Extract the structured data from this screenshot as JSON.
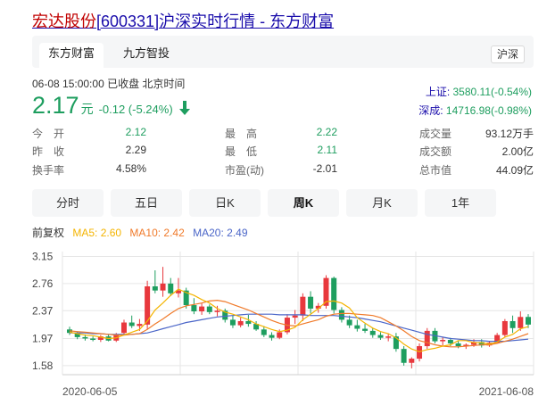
{
  "page_title": {
    "stock_name": "宏达股份",
    "code": "[600331]",
    "suffix": "沪深实时行情 - 东方财富"
  },
  "tabs": [
    {
      "label": "东方财富",
      "active": true
    },
    {
      "label": "九方智投",
      "active": false
    }
  ],
  "market_button": "沪深",
  "quote": {
    "status": "06-08 15:00:00  已收盘  北京时间",
    "price": "2.17",
    "unit": "元",
    "change": "-0.12 (-5.24%)",
    "trend": "down"
  },
  "indices": [
    {
      "name": "上证:",
      "value": "3580.11(-0.54%)"
    },
    {
      "name": "深成:",
      "value": "14716.98(-0.98%)"
    }
  ],
  "stats": [
    [
      {
        "label": "今　开",
        "value": "2.12",
        "color": "green"
      },
      {
        "label": "最　高",
        "value": "2.22",
        "color": "green"
      },
      {
        "label": "成交量",
        "value": "93.12万手",
        "color": "dark"
      }
    ],
    [
      {
        "label": "昨　收",
        "value": "2.29",
        "color": "dark"
      },
      {
        "label": "最　低",
        "value": "2.11",
        "color": "green"
      },
      {
        "label": "成交额",
        "value": "2.00亿",
        "color": "dark"
      }
    ],
    [
      {
        "label": "换手率",
        "value": "4.58%",
        "color": "dark"
      },
      {
        "label": "市盈(动)",
        "value": "-2.01",
        "color": "dark"
      },
      {
        "label": "总市值",
        "value": "44.09亿",
        "color": "dark"
      }
    ]
  ],
  "periods": [
    {
      "label": "分时",
      "active": false
    },
    {
      "label": "五日",
      "active": false
    },
    {
      "label": "日K",
      "active": false
    },
    {
      "label": "周K",
      "active": true
    },
    {
      "label": "月K",
      "active": false
    },
    {
      "label": "1年",
      "active": false
    }
  ],
  "ma_legend": {
    "adjust": "前复权",
    "ma5": "MA5: 2.60",
    "ma10": "MA10: 2.42",
    "ma20": "MA20: 2.49"
  },
  "colors": {
    "up": "#e8383d",
    "down": "#1e9e5f",
    "ma5": "#f4b400",
    "ma10": "#f07a2a",
    "ma20": "#4b66c8",
    "grid": "#e6e6e6"
  },
  "chart_data": {
    "type": "candlestick",
    "y_ticks": [
      "3.15",
      "2.76",
      "2.37",
      "1.97",
      "1.58"
    ],
    "ylim": [
      1.45,
      3.22
    ],
    "x_labels": {
      "start": "2020-06-05",
      "end": "2021-06-08"
    },
    "grid": true,
    "candles": [
      {
        "o": 2.1,
        "h": 2.14,
        "l": 2.02,
        "c": 2.05
      },
      {
        "o": 2.05,
        "h": 2.07,
        "l": 1.96,
        "c": 1.99
      },
      {
        "o": 1.99,
        "h": 2.03,
        "l": 1.94,
        "c": 1.97
      },
      {
        "o": 1.97,
        "h": 2.0,
        "l": 1.93,
        "c": 1.95
      },
      {
        "o": 1.95,
        "h": 2.02,
        "l": 1.92,
        "c": 2.0
      },
      {
        "o": 2.0,
        "h": 2.03,
        "l": 1.93,
        "c": 1.94
      },
      {
        "o": 1.94,
        "h": 2.05,
        "l": 1.92,
        "c": 2.03
      },
      {
        "o": 2.05,
        "h": 2.24,
        "l": 2.03,
        "c": 2.2
      },
      {
        "o": 2.2,
        "h": 2.3,
        "l": 2.12,
        "c": 2.15
      },
      {
        "o": 2.15,
        "h": 2.25,
        "l": 2.08,
        "c": 2.18
      },
      {
        "o": 2.17,
        "h": 2.8,
        "l": 2.1,
        "c": 2.72
      },
      {
        "o": 2.72,
        "h": 2.95,
        "l": 2.62,
        "c": 2.66
      },
      {
        "o": 2.66,
        "h": 3.0,
        "l": 2.57,
        "c": 2.76
      },
      {
        "o": 2.76,
        "h": 2.84,
        "l": 2.58,
        "c": 2.62
      },
      {
        "o": 2.62,
        "h": 2.84,
        "l": 2.56,
        "c": 2.66
      },
      {
        "o": 2.66,
        "h": 2.7,
        "l": 2.4,
        "c": 2.45
      },
      {
        "o": 2.45,
        "h": 2.55,
        "l": 2.32,
        "c": 2.36
      },
      {
        "o": 2.36,
        "h": 2.48,
        "l": 2.31,
        "c": 2.43
      },
      {
        "o": 2.43,
        "h": 2.46,
        "l": 2.32,
        "c": 2.35
      },
      {
        "o": 2.35,
        "h": 2.44,
        "l": 2.29,
        "c": 2.37
      },
      {
        "o": 2.37,
        "h": 2.4,
        "l": 2.2,
        "c": 2.24
      },
      {
        "o": 2.24,
        "h": 2.3,
        "l": 2.12,
        "c": 2.16
      },
      {
        "o": 2.16,
        "h": 2.27,
        "l": 2.13,
        "c": 2.22
      },
      {
        "o": 2.22,
        "h": 2.31,
        "l": 2.14,
        "c": 2.18
      },
      {
        "o": 2.18,
        "h": 2.22,
        "l": 2.08,
        "c": 2.1
      },
      {
        "o": 2.1,
        "h": 2.15,
        "l": 1.99,
        "c": 2.02
      },
      {
        "o": 2.02,
        "h": 2.06,
        "l": 1.94,
        "c": 1.98
      },
      {
        "o": 1.98,
        "h": 2.1,
        "l": 1.96,
        "c": 2.06
      },
      {
        "o": 2.06,
        "h": 2.32,
        "l": 2.03,
        "c": 2.27
      },
      {
        "o": 2.27,
        "h": 2.38,
        "l": 2.18,
        "c": 2.3
      },
      {
        "o": 2.3,
        "h": 2.62,
        "l": 2.22,
        "c": 2.57
      },
      {
        "o": 2.57,
        "h": 2.65,
        "l": 2.33,
        "c": 2.4
      },
      {
        "o": 2.4,
        "h": 2.48,
        "l": 2.34,
        "c": 2.44
      },
      {
        "o": 2.44,
        "h": 2.88,
        "l": 2.4,
        "c": 2.84
      },
      {
        "o": 2.84,
        "h": 2.86,
        "l": 2.33,
        "c": 2.38
      },
      {
        "o": 2.38,
        "h": 2.42,
        "l": 2.2,
        "c": 2.24
      },
      {
        "o": 2.24,
        "h": 2.3,
        "l": 2.12,
        "c": 2.16
      },
      {
        "o": 2.16,
        "h": 2.24,
        "l": 2.07,
        "c": 2.11
      },
      {
        "o": 2.11,
        "h": 2.18,
        "l": 2.05,
        "c": 2.08
      },
      {
        "o": 2.08,
        "h": 2.12,
        "l": 1.98,
        "c": 2.02
      },
      {
        "o": 2.02,
        "h": 2.06,
        "l": 1.95,
        "c": 1.98
      },
      {
        "o": 1.98,
        "h": 2.04,
        "l": 1.93,
        "c": 2.0
      },
      {
        "o": 2.0,
        "h": 2.05,
        "l": 1.78,
        "c": 1.82
      },
      {
        "o": 1.82,
        "h": 1.86,
        "l": 1.58,
        "c": 1.62
      },
      {
        "o": 1.62,
        "h": 1.7,
        "l": 1.54,
        "c": 1.68
      },
      {
        "o": 1.68,
        "h": 1.9,
        "l": 1.64,
        "c": 1.86
      },
      {
        "o": 1.86,
        "h": 2.12,
        "l": 1.82,
        "c": 2.08
      },
      {
        "o": 2.08,
        "h": 2.12,
        "l": 1.9,
        "c": 1.93
      },
      {
        "o": 1.93,
        "h": 1.99,
        "l": 1.87,
        "c": 1.95
      },
      {
        "o": 1.95,
        "h": 1.98,
        "l": 1.86,
        "c": 1.9
      },
      {
        "o": 1.9,
        "h": 1.94,
        "l": 1.83,
        "c": 1.86
      },
      {
        "o": 1.86,
        "h": 1.9,
        "l": 1.82,
        "c": 1.88
      },
      {
        "o": 1.88,
        "h": 1.96,
        "l": 1.85,
        "c": 1.92
      },
      {
        "o": 1.92,
        "h": 1.96,
        "l": 1.84,
        "c": 1.87
      },
      {
        "o": 1.87,
        "h": 1.93,
        "l": 1.85,
        "c": 1.91
      },
      {
        "o": 1.91,
        "h": 2.05,
        "l": 1.9,
        "c": 2.02
      },
      {
        "o": 2.02,
        "h": 2.25,
        "l": 1.99,
        "c": 2.22
      },
      {
        "o": 2.22,
        "h": 2.3,
        "l": 2.05,
        "c": 2.12
      },
      {
        "o": 2.12,
        "h": 2.36,
        "l": 2.08,
        "c": 2.28
      },
      {
        "o": 2.28,
        "h": 2.32,
        "l": 2.12,
        "c": 2.17
      }
    ],
    "ma5": [
      2.06,
      2.04,
      2.02,
      2.01,
      1.99,
      1.97,
      1.98,
      2.02,
      2.06,
      2.1,
      2.22,
      2.38,
      2.48,
      2.59,
      2.68,
      2.63,
      2.59,
      2.53,
      2.48,
      2.4,
      2.35,
      2.32,
      2.28,
      2.24,
      2.18,
      2.14,
      2.1,
      2.07,
      2.09,
      2.13,
      2.24,
      2.32,
      2.4,
      2.5,
      2.51,
      2.48,
      2.41,
      2.27,
      2.19,
      2.12,
      2.07,
      2.04,
      1.98,
      1.89,
      1.82,
      1.78,
      1.81,
      1.83,
      1.86,
      1.88,
      1.94,
      1.94,
      1.91,
      1.91,
      1.89,
      1.92,
      1.99,
      2.03,
      2.11,
      2.14
    ],
    "ma10": [
      2.08,
      2.07,
      2.06,
      2.05,
      2.04,
      2.03,
      2.02,
      2.02,
      2.03,
      2.04,
      2.1,
      2.18,
      2.25,
      2.33,
      2.4,
      2.44,
      2.46,
      2.48,
      2.51,
      2.52,
      2.5,
      2.46,
      2.42,
      2.38,
      2.33,
      2.28,
      2.23,
      2.19,
      2.16,
      2.15,
      2.18,
      2.21,
      2.24,
      2.29,
      2.32,
      2.33,
      2.33,
      2.32,
      2.31,
      2.3,
      2.27,
      2.21,
      2.15,
      2.08,
      2.0,
      1.94,
      1.91,
      1.88,
      1.86,
      1.85,
      1.85,
      1.86,
      1.87,
      1.88,
      1.88,
      1.9,
      1.93,
      1.96,
      2.0,
      2.04
    ],
    "ma20": [
      2.05,
      2.05,
      2.05,
      2.04,
      2.04,
      2.03,
      2.03,
      2.03,
      2.03,
      2.04,
      2.05,
      2.08,
      2.11,
      2.14,
      2.17,
      2.2,
      2.22,
      2.24,
      2.26,
      2.28,
      2.29,
      2.3,
      2.31,
      2.32,
      2.32,
      2.32,
      2.32,
      2.31,
      2.31,
      2.31,
      2.31,
      2.3,
      2.3,
      2.3,
      2.3,
      2.29,
      2.28,
      2.27,
      2.25,
      2.23,
      2.21,
      2.18,
      2.15,
      2.12,
      2.09,
      2.06,
      2.03,
      2.01,
      1.99,
      1.97,
      1.96,
      1.95,
      1.94,
      1.94,
      1.93,
      1.93,
      1.93,
      1.94,
      1.95,
      1.96
    ]
  }
}
